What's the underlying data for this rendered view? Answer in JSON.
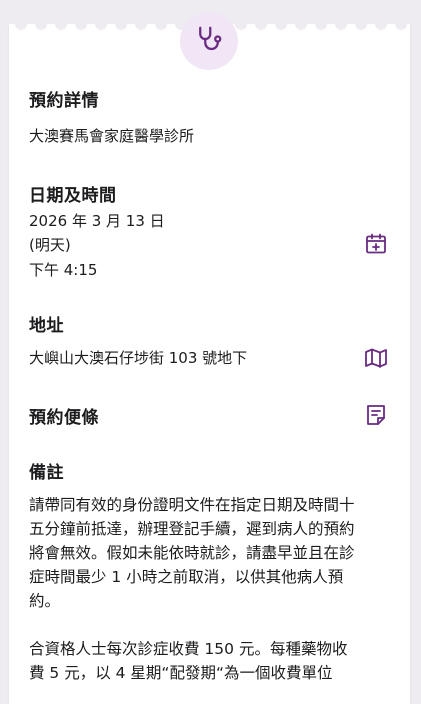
{
  "booking": {
    "details_title": "預約詳情",
    "clinic_name": "大澳賽馬會家庭醫學診所",
    "datetime_title": "日期及時間",
    "date": "2026 年 3 月 13 日",
    "relative_day": "(明天)",
    "time": "下午 4:15",
    "address_title": "地址",
    "address": "大嶼山大澳石仔埗街 103 號地下",
    "memo_title": "預約便條",
    "remarks_title": "備註",
    "remarks_p1": "請帶同有效的身份證明文件在指定日期及時間十五分鐘前抵達，辦理登記手續，遲到病人的預約將會無效。假如未能依時就診，請盡早並且在診症時間最少 1 小時之前取消，以供其他病人預約。",
    "remarks_p2": "合資格人士每次診症收費 150 元。每種藥物收費 5 元，以 4 星期“配發期“為一個收費單位"
  },
  "icons": {
    "header": "stethoscope-icon",
    "calendar": "calendar-add-icon",
    "map": "map-icon",
    "memo": "note-icon"
  },
  "colors": {
    "accent": "#6a2b82",
    "badge_bg": "#f1e6f5",
    "background": "#efecf1"
  }
}
